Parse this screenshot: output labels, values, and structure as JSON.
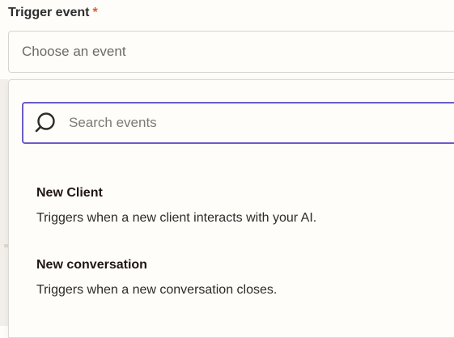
{
  "field": {
    "label": "Trigger event",
    "required_marker": "*"
  },
  "select": {
    "placeholder": "Choose an event"
  },
  "search": {
    "placeholder": "Search events",
    "value": ""
  },
  "events": [
    {
      "title": "New Client",
      "description": "Triggers when a new client interacts with your AI."
    },
    {
      "title": "New conversation",
      "description": "Triggers when a new conversation closes."
    }
  ],
  "colors": {
    "accent": "#6b5bc9",
    "required": "#e2592e",
    "background": "#fffdf9"
  },
  "icons": {
    "search": "search-icon"
  }
}
